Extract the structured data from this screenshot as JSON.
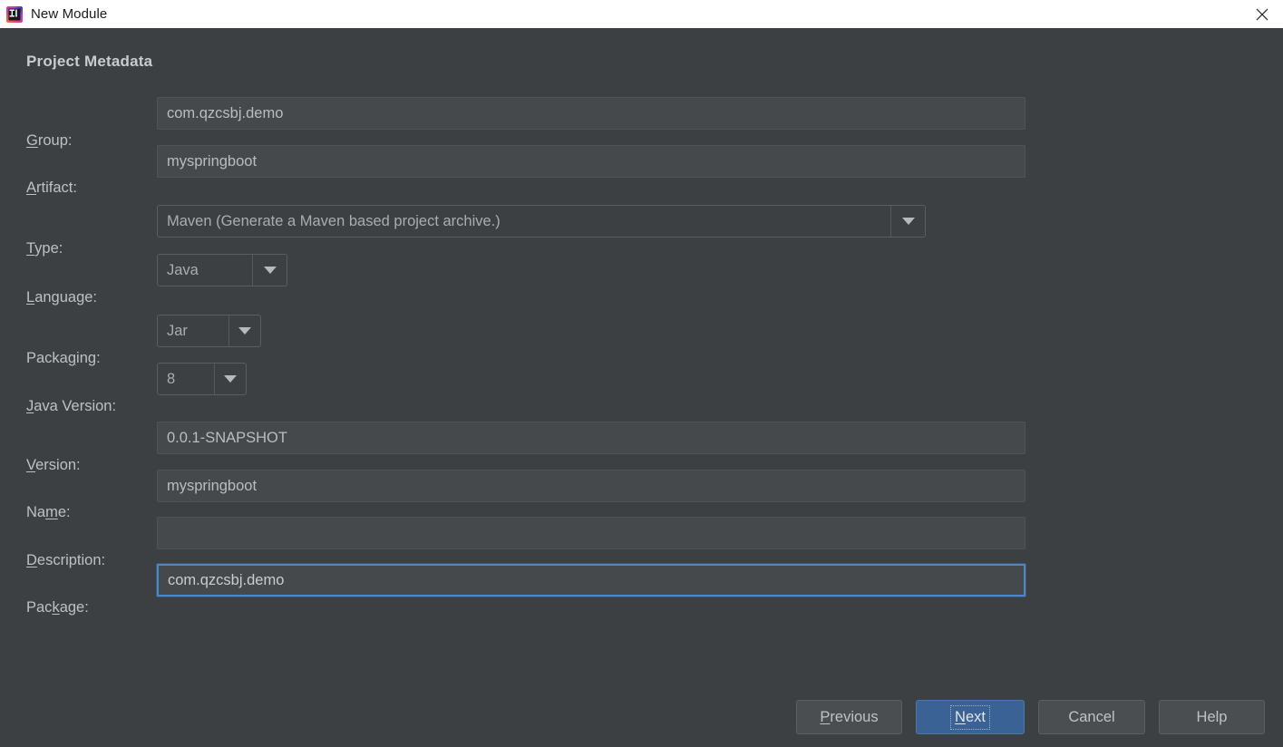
{
  "window": {
    "title": "New Module",
    "icon": "intellij-idea-icon",
    "close_icon": "close-icon",
    "background": "#3c4042"
  },
  "dialog": {
    "section_title": "Project Metadata",
    "fields": [
      {
        "id": "group",
        "label": "Group:",
        "mnemonic": "G",
        "type": "text",
        "value": "com.qzcsbj.demo",
        "focused": false
      },
      {
        "id": "artifact",
        "label": "Artifact:",
        "mnemonic": "A",
        "type": "text",
        "value": "myspringboot",
        "focused": false
      },
      {
        "id": "type",
        "label": "Type:",
        "mnemonic": "T",
        "type": "combo",
        "value": "Maven (Generate a Maven based project archive.)"
      },
      {
        "id": "language",
        "label": "Language:",
        "mnemonic": "L",
        "type": "combo",
        "value": "Java"
      },
      {
        "id": "packaging",
        "label": "Packaging:",
        "mnemonic": "g",
        "type": "combo",
        "value": "Jar"
      },
      {
        "id": "java-version",
        "label": "Java Version:",
        "mnemonic": "J",
        "type": "combo",
        "value": "8"
      },
      {
        "id": "version",
        "label": "Version:",
        "mnemonic": "V",
        "type": "text",
        "value": "0.0.1-SNAPSHOT",
        "focused": false
      },
      {
        "id": "name",
        "label": "Name:",
        "mnemonic": "m",
        "type": "text",
        "value": "myspringboot",
        "focused": false
      },
      {
        "id": "description",
        "label": "Description:",
        "mnemonic": "D",
        "type": "text",
        "value": "",
        "focused": false
      },
      {
        "id": "package",
        "label": "Package:",
        "mnemonic": "k",
        "type": "text",
        "value": "com.qzcsbj.demo",
        "focused": true
      }
    ],
    "labels": {
      "group_pre": "",
      "group_mn": "G",
      "group_post": "roup:",
      "artifact_pre": "",
      "artifact_mn": "A",
      "artifact_post": "rtifact:",
      "type_pre": "",
      "type_mn": "T",
      "type_post": "ype:",
      "language_pre": "",
      "language_mn": "L",
      "language_post": "anguage:",
      "packaging_pre": "Packa",
      "packaging_mn": "g",
      "packaging_post": "ing:",
      "javaversion_pre": "",
      "javaversion_mn": "J",
      "javaversion_post": "ava Version:",
      "version_pre": "",
      "version_mn": "V",
      "version_post": "ersion:",
      "name_pre": "Na",
      "name_mn": "m",
      "name_post": "e:",
      "description_pre": "",
      "description_mn": "D",
      "description_post": "escription:",
      "package_pre": "Pac",
      "package_mn": "k",
      "package_post": "age:"
    },
    "values": {
      "group": "com.qzcsbj.demo",
      "artifact": "myspringboot",
      "type": "Maven (Generate a Maven based project archive.)",
      "language": "Java",
      "packaging": "Jar",
      "java_version": "8",
      "version": "0.0.1-SNAPSHOT",
      "name": "myspringboot",
      "description": "",
      "package": "com.qzcsbj.demo"
    }
  },
  "buttons": {
    "previous": {
      "pre": "",
      "mn": "P",
      "post": "revious"
    },
    "next": {
      "pre": "",
      "mn": "N",
      "post": "ext",
      "primary": true,
      "focused": true
    },
    "cancel": {
      "label": "Cancel"
    },
    "help": {
      "label": "Help"
    }
  },
  "colors": {
    "dialog_bg": "#3c4042",
    "titlebar_bg": "#ffffff",
    "field_bg": "#45494b",
    "label_fg": "#bdc1c2",
    "accent_blue": "#3a6295",
    "focus_blue": "#4a88c7"
  }
}
